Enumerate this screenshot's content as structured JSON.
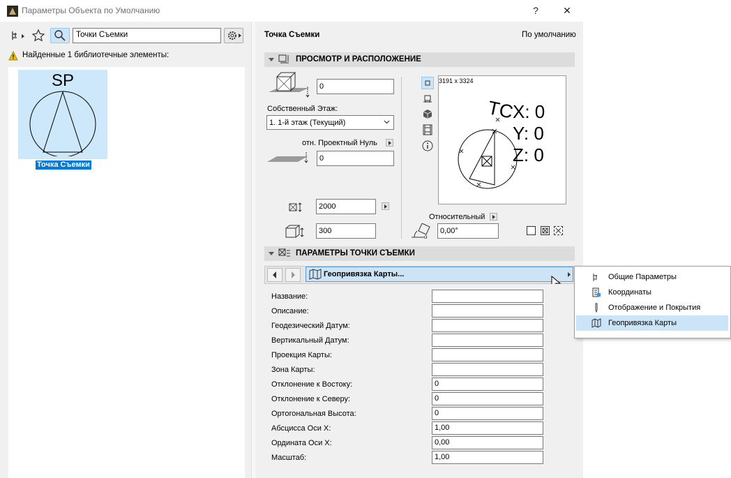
{
  "window": {
    "title": "Параметры Объекта по Умолчанию",
    "help": "?",
    "close": "✕"
  },
  "left": {
    "search_value": "Точки Съемки",
    "found_text": "Найденные 1 библиотечные элементы:",
    "item": {
      "thumb_text": "SP",
      "label": "Точка Съемки"
    }
  },
  "right": {
    "object_name": "Точка Съемки",
    "default_label": "По умолчанию",
    "section1": {
      "title": "ПРОСМОТР И РАСПОЛОЖЕНИЕ"
    },
    "elevation_value": "0",
    "home_story_label": "Собственный Этаж:",
    "home_story_value": "1. 1-й этаж (Текущий)",
    "ref_label": "отн. Проектный Нуль",
    "ref_value": "0",
    "size_value": "2000",
    "height_value": "300",
    "relative_label": "Относительный",
    "angle_value": "0,00°",
    "preview": {
      "dims": "3191 x 3324",
      "tc": "TC",
      "x": "X: 0",
      "y": "Y: 0",
      "z": "Z: 0"
    },
    "section2": {
      "title": "ПАРАМЕТРЫ ТОЧКИ СЪЕМКИ"
    },
    "nav_selected": "Геопривязка Карты...",
    "fields": [
      {
        "label": "Название:",
        "value": ""
      },
      {
        "label": "Описание:",
        "value": ""
      },
      {
        "label": "Геодезический Датум:",
        "value": ""
      },
      {
        "label": "Вертикальный Датум:",
        "value": ""
      },
      {
        "label": "Проекция Карты:",
        "value": ""
      },
      {
        "label": "Зона Карты:",
        "value": ""
      },
      {
        "label": "Отклонение к Востоку:",
        "value": "0"
      },
      {
        "label": "Отклонение к Северу:",
        "value": "0"
      },
      {
        "label": "Ортогональная Высота:",
        "value": "0"
      },
      {
        "label": "Абсцисса Оси X:",
        "value": "1,00"
      },
      {
        "label": "Ордината Оси X:",
        "value": "0,00"
      },
      {
        "label": "Масштаб:",
        "value": "1,00"
      }
    ]
  },
  "popup": {
    "items": [
      {
        "label": "Общие Параметры",
        "icon": "params-icon"
      },
      {
        "label": "Координаты",
        "icon": "coordinates-icon"
      },
      {
        "label": "Отображение и Покрытия",
        "icon": "pen-icon"
      },
      {
        "label": "Геопривязка Карты",
        "icon": "map-icon"
      }
    ],
    "selected_index": 3
  },
  "colors": {
    "selection": "#cce4f7",
    "accent": "#0078d7"
  }
}
